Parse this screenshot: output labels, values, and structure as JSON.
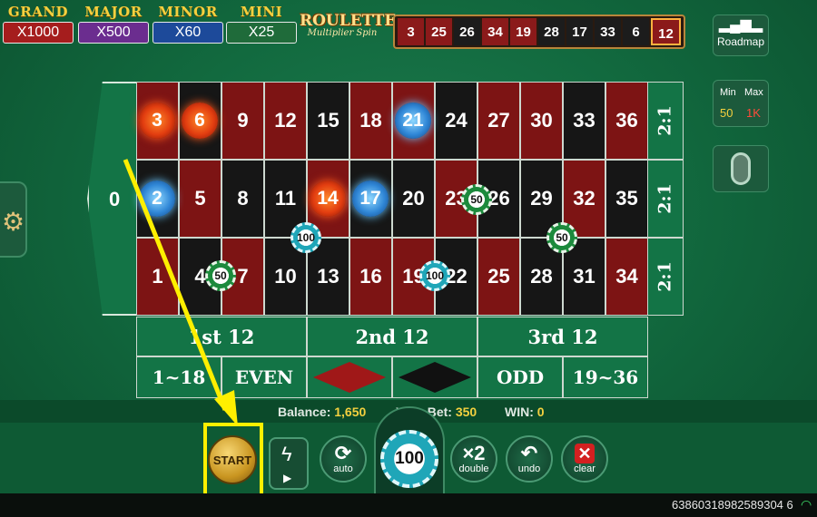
{
  "jackpots": [
    {
      "name": "GRAND",
      "value": "X1000",
      "bg": "#a51d1d"
    },
    {
      "name": "MAJOR",
      "value": "X500",
      "bg": "#6b2d8f"
    },
    {
      "name": "MINOR",
      "value": "X60",
      "bg": "#1d4a9a"
    },
    {
      "name": "MINI",
      "value": "X25",
      "bg": "#1f6b3a"
    }
  ],
  "logo": {
    "main": "ROULETTE",
    "sub": "Multiplier Spin"
  },
  "history": [
    "3",
    "25",
    "26",
    "34",
    "19",
    "28",
    "17",
    "33",
    "6",
    "12"
  ],
  "roadmap_label": "Roadmap",
  "limits": {
    "min_label": "Min",
    "max_label": "Max",
    "min": "50",
    "max": "1K"
  },
  "board": {
    "zero": "0",
    "top": [
      "3",
      "6",
      "9",
      "12",
      "15",
      "18",
      "21",
      "24",
      "27",
      "30",
      "33",
      "36"
    ],
    "mid": [
      "2",
      "5",
      "8",
      "11",
      "14",
      "17",
      "20",
      "23",
      "26",
      "29",
      "32",
      "35"
    ],
    "bot": [
      "1",
      "4",
      "7",
      "10",
      "13",
      "16",
      "19",
      "22",
      "25",
      "28",
      "31",
      "34"
    ],
    "columns": [
      "2:1",
      "2:1",
      "2:1"
    ],
    "dozens": [
      "1st 12",
      "2nd 12",
      "3rd 12"
    ],
    "low": "1~18",
    "even": "EVEN",
    "odd": "ODD",
    "high": "19~36"
  },
  "chips": {
    "c50": "50",
    "c100": "100"
  },
  "status": {
    "balance_label": "Balance:",
    "balance": "1,650",
    "bet_label": "Your Bet:",
    "bet": "350",
    "win_label": "WIN:",
    "win": "0"
  },
  "controls": {
    "start": "START",
    "auto": "auto",
    "double_icon": "×2",
    "double": "double",
    "undo": "undo",
    "clear": "clear",
    "chip_value": "100"
  },
  "footer_id": "63860318982589304 6",
  "colors": {
    "red": "#7d1414",
    "black": "#161616",
    "felt": "#137446",
    "highlight": "#ffef00"
  }
}
